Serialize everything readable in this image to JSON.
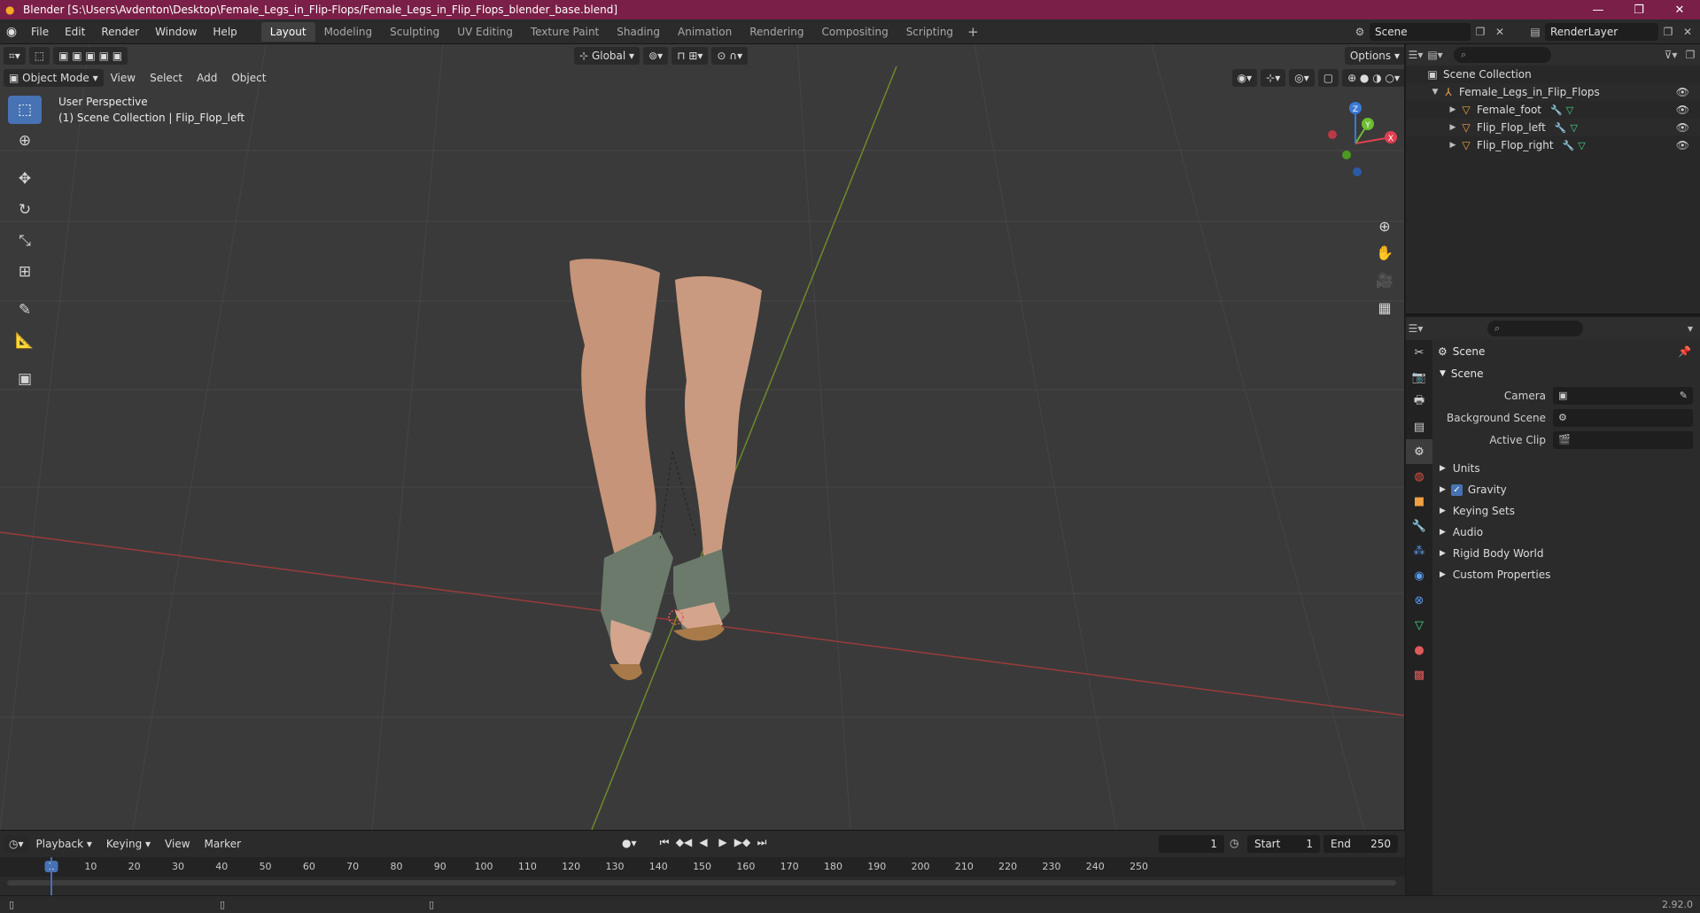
{
  "window": {
    "title": "Blender [S:\\Users\\Avdenton\\Desktop\\Female_Legs_in_Flip-Flops/Female_Legs_in_Flip_Flops_blender_base.blend]",
    "minimize": "—",
    "maximize": "❐",
    "close": "✕"
  },
  "menubar": {
    "items": [
      "File",
      "Edit",
      "Render",
      "Window",
      "Help"
    ],
    "workspaces": [
      "Layout",
      "Modeling",
      "Sculpting",
      "UV Editing",
      "Texture Paint",
      "Shading",
      "Animation",
      "Rendering",
      "Compositing",
      "Scripting"
    ],
    "active_workspace": "Layout",
    "scene": "Scene",
    "render_layer": "RenderLayer"
  },
  "viewport": {
    "mode": "Object Mode",
    "menus": [
      "View",
      "Select",
      "Add",
      "Object"
    ],
    "transform_orientation": "Global",
    "options_label": "Options",
    "perspective_label": "User Perspective",
    "collection_label": "(1) Scene Collection | Flip_Flop_left",
    "gizmo": {
      "x": "X",
      "y": "Y",
      "z": "Z"
    }
  },
  "outliner": {
    "root": "Scene Collection",
    "collection": "Female_Legs_in_Flip_Flops",
    "objects": [
      "Female_foot",
      "Flip_Flop_left",
      "Flip_Flop_right"
    ]
  },
  "properties": {
    "breadcrumb": "Scene",
    "panel_title": "Scene",
    "fields": [
      {
        "label": "Camera",
        "value": ""
      },
      {
        "label": "Background Scene",
        "value": ""
      },
      {
        "label": "Active Clip",
        "value": ""
      }
    ],
    "subpanels": [
      "Units",
      "Gravity",
      "Keying Sets",
      "Audio",
      "Rigid Body World",
      "Custom Properties"
    ]
  },
  "timeline": {
    "menus": [
      "Playback",
      "Keying",
      "View",
      "Marker"
    ],
    "current_frame": "1",
    "start_label": "Start",
    "start_value": "1",
    "end_label": "End",
    "end_value": "250",
    "ruler": [
      "1",
      "10",
      "20",
      "30",
      "40",
      "50",
      "60",
      "70",
      "80",
      "90",
      "100",
      "110",
      "120",
      "130",
      "140",
      "150",
      "160",
      "170",
      "180",
      "190",
      "200",
      "210",
      "220",
      "230",
      "240",
      "250"
    ]
  },
  "status": {
    "version": "2.92.0"
  }
}
